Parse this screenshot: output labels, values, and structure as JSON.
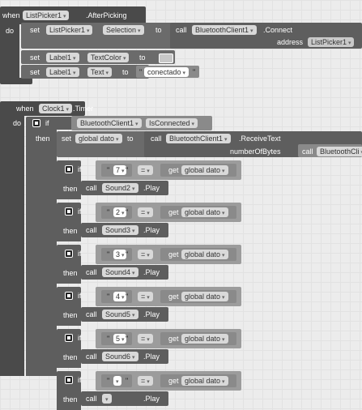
{
  "event1": {
    "when": "when",
    "component": "ListPicker1",
    "event": ".AfterPicking",
    "do": "do",
    "set": "set",
    "prop_selection": "Selection",
    "to": "to",
    "call": "call",
    "bt_component": "BluetoothClient1",
    "method_connect": ".Connect",
    "arg_address": "address",
    "listpicker_ref": "ListPicker1",
    "label_component": "Label1",
    "prop_textcolor": "TextColor",
    "prop_text": "Text",
    "string_value": "conectado"
  },
  "event2": {
    "when": "when",
    "component": "Clock1",
    "event": ".Timer",
    "do": "do",
    "if": "if",
    "then": "then",
    "bt_component": "BluetoothClient1",
    "prop_isconnected": "IsConnected",
    "set": "set",
    "global_var": "global dato",
    "to": "to",
    "call": "call",
    "method_receive": ".ReceiveText",
    "arg_numbytes": "numberOfBytes",
    "bt_component_truncated": "BluetoothCli",
    "get": "get"
  },
  "conditions": [
    {
      "value": "7",
      "sound": "Sound2"
    },
    {
      "value": "2",
      "sound": "Sound3"
    },
    {
      "value": "3",
      "sound": "Sound4"
    },
    {
      "value": "4",
      "sound": "Sound5"
    },
    {
      "value": "5",
      "sound": "Sound6"
    },
    {
      "value": "",
      "sound": ""
    }
  ],
  "labels": {
    "op_equals": "=",
    "play": ".Play",
    "if": "if",
    "then": "then",
    "call": "call",
    "get": "get",
    "global_var": "global dato"
  }
}
